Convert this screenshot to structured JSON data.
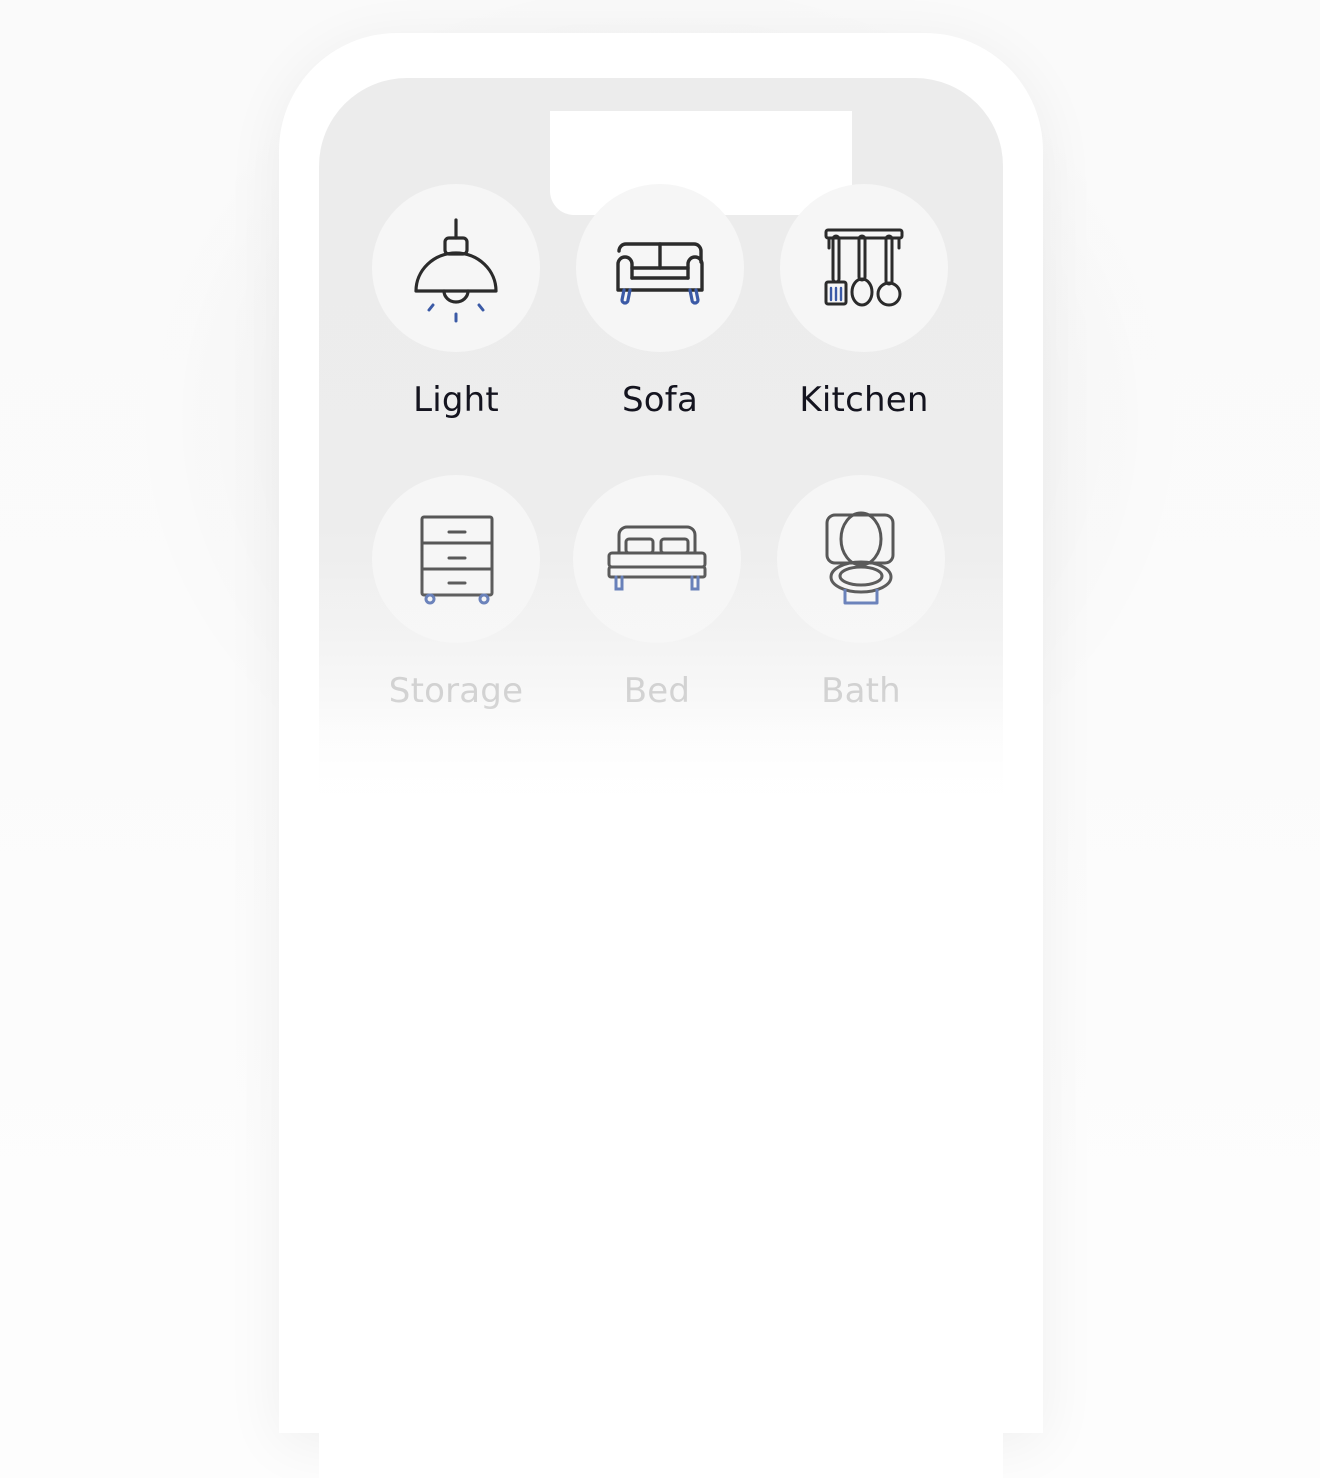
{
  "categories": [
    {
      "label": "Light",
      "icon": "pendant-lamp-icon"
    },
    {
      "label": "Sofa",
      "icon": "sofa-icon"
    },
    {
      "label": "Kitchen",
      "icon": "kitchen-utensils-icon"
    },
    {
      "label": "Storage",
      "icon": "drawer-cabinet-icon"
    },
    {
      "label": "Bed",
      "icon": "bed-icon"
    },
    {
      "label": "Bath",
      "icon": "toilet-icon"
    }
  ],
  "colors": {
    "icon_stroke": "#2b2b2b",
    "icon_accent": "#3b5aa6",
    "label_active": "#14141f",
    "label_faded": "#cbcbcb",
    "circle_bg": "#f6f6f6"
  }
}
